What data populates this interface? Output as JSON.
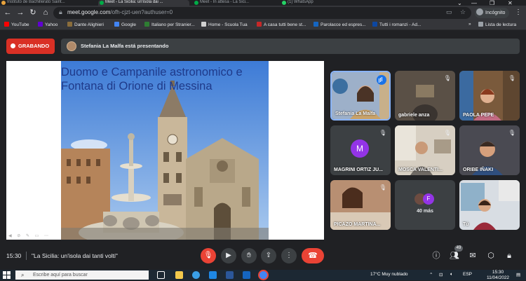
{
  "browser": {
    "tabs": [
      {
        "label": "Instituto de Bachillerato Saint..."
      },
      {
        "label": "Meet - La Sicilia: un'isola dai ..."
      },
      {
        "label": "Meet - In attesa - La Sici..."
      },
      {
        "label": "(1) WhatsApp"
      }
    ],
    "url_host": "meet.google.com",
    "url_path": "/ofh-cjzt-uen?authuser=0",
    "profile_label": "Incógnito",
    "bookmarks": [
      {
        "label": "YouTube",
        "color": "#ff0000"
      },
      {
        "label": "Yahoo",
        "color": "#6001d2"
      },
      {
        "label": "Dante Alighieri",
        "color": "#8a6d3b"
      },
      {
        "label": "Google",
        "color": "#4285f4"
      },
      {
        "label": "Italiano per Stranier...",
        "color": "#2e7d32"
      },
      {
        "label": "Home - Scuola Tua",
        "color": "#d0d0d0"
      },
      {
        "label": "A casa tutti bene st...",
        "color": "#c62828"
      },
      {
        "label": "Parolacce ed espres...",
        "color": "#1565c0"
      },
      {
        "label": "Tutti i romanzi - Ad...",
        "color": "#0d47a1"
      }
    ],
    "reading_list": "Lista de lectura"
  },
  "meet": {
    "recording_label": "GRABANDO",
    "presenting_text": "Stefania La Malfa está presentando",
    "slide_title": "Duomo e Campanile astronomico e Fontana di Orione di Messina",
    "participants": [
      {
        "name": "Stefania La Malfa",
        "active": true
      },
      {
        "name": "gabriele anza"
      },
      {
        "name": "PAOLA PEPE"
      },
      {
        "name": "MAGRINI ORTIZ JU...",
        "initial": "M"
      },
      {
        "name": "MOSCA VALENTI..."
      },
      {
        "name": "ORIBE IÑAKI"
      },
      {
        "name": "PICAZO MARTINA..."
      },
      {
        "more_label": "40 más",
        "initial": "F"
      },
      {
        "name": "Tú"
      }
    ],
    "time": "15:30",
    "meeting_name": "\"La Sicilia: un'isola dai tanti volti\"",
    "people_count": "49"
  },
  "taskbar": {
    "search_placeholder": "Escribe aquí para buscar",
    "weather": "17°C  Muy nublado",
    "lang": "ESP",
    "clock_time": "15:30",
    "clock_date": "11/04/2022"
  }
}
